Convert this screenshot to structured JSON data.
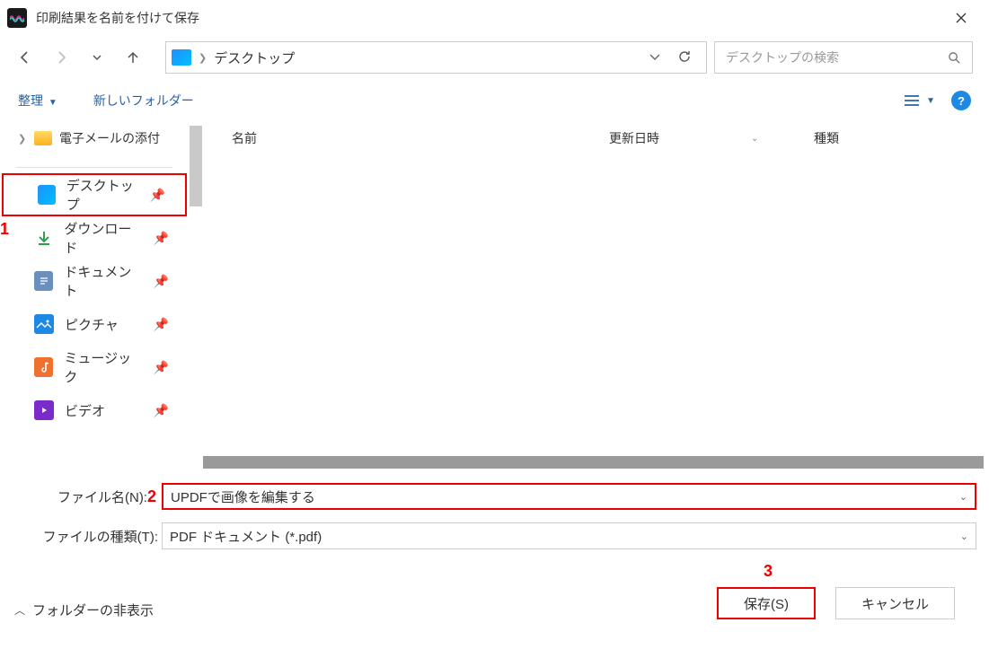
{
  "window": {
    "title": "印刷結果を名前を付けて保存"
  },
  "nav": {
    "location": "デスクトップ",
    "search_placeholder": "デスクトップの検索"
  },
  "toolbar": {
    "organize": "整理",
    "new_folder": "新しいフォルダー"
  },
  "tree": {
    "item0": "電子メールの添付"
  },
  "sidebar": {
    "items": [
      {
        "label": "デスクトップ"
      },
      {
        "label": "ダウンロード"
      },
      {
        "label": "ドキュメント"
      },
      {
        "label": "ピクチャ"
      },
      {
        "label": "ミュージック"
      },
      {
        "label": "ビデオ"
      }
    ]
  },
  "columns": {
    "name": "名前",
    "date": "更新日時",
    "type": "種類"
  },
  "form": {
    "filename_label": "ファイル名(N):",
    "filename_value": "UPDFで画像を編集する",
    "filetype_label": "ファイルの種類(T):",
    "filetype_value": "PDF ドキュメント (*.pdf)"
  },
  "footer": {
    "hide_folders": "フォルダーの非表示",
    "save": "保存(S)",
    "cancel": "キャンセル"
  },
  "markers": {
    "m1": "1",
    "m2": "2",
    "m3": "3"
  }
}
